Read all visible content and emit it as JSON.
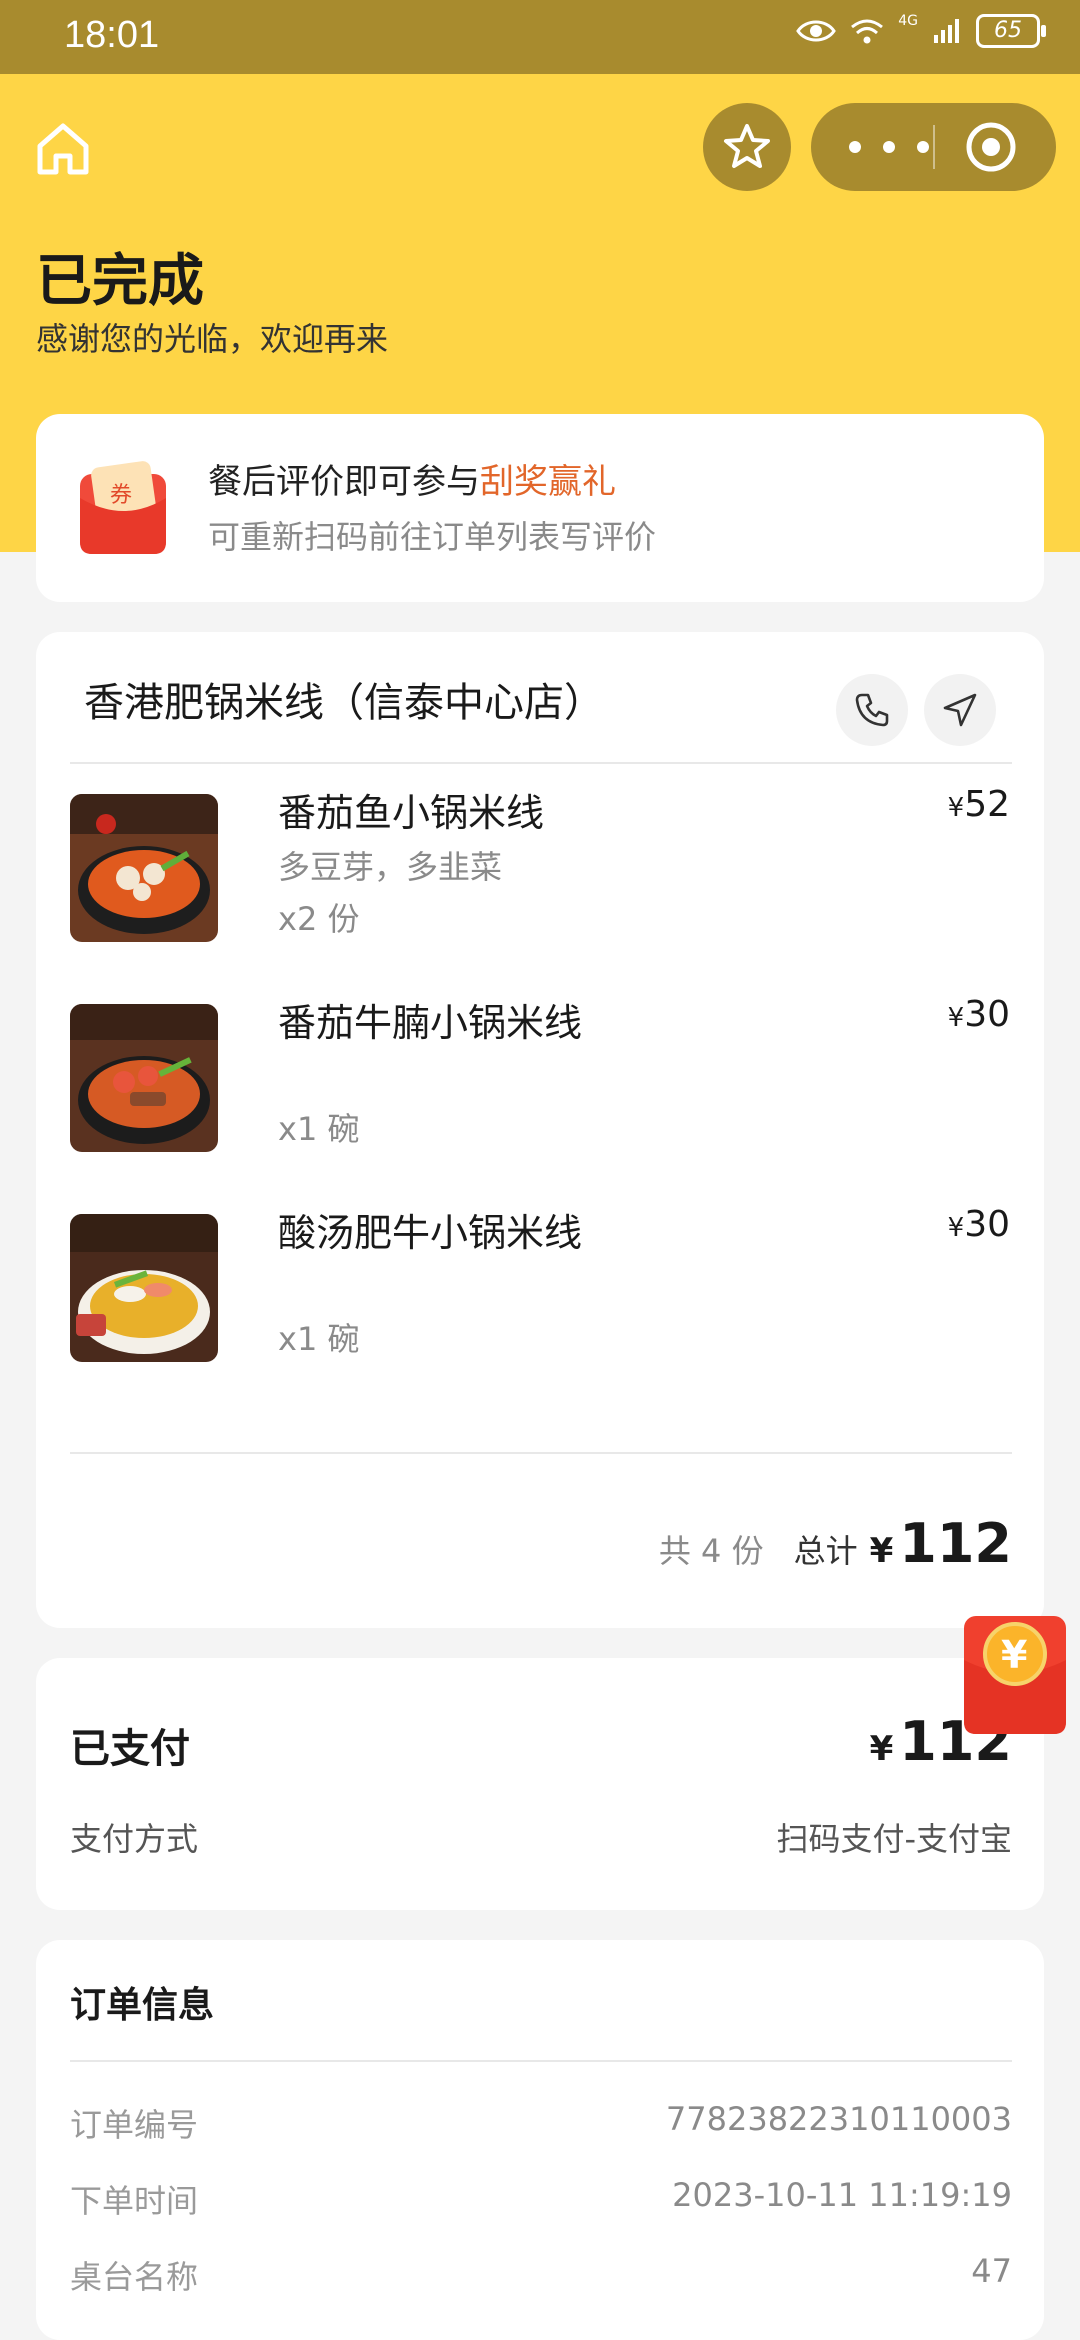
{
  "status_bar": {
    "time": "18:01",
    "network": "4G",
    "battery": "65"
  },
  "header": {
    "title": "已完成",
    "subtitle": "感谢您的光临，欢迎再来"
  },
  "nav_icons": [
    "home-icon",
    "star-icon",
    "more-icon",
    "target-icon"
  ],
  "promo": {
    "icon_text": "券",
    "line1_prefix": "餐后评价即可参与",
    "line1_highlight": "刮奖赢礼",
    "line2": "可重新扫码前往订单列表写评价",
    "highlight_color": "#e2662a"
  },
  "order": {
    "shop_name": "香港肥锅米线（信泰中心店）",
    "items": [
      {
        "name": "番茄鱼小锅米线",
        "note": "多豆芽，多韭菜",
        "qty": "x2 份",
        "currency": "¥",
        "price": "52"
      },
      {
        "name": "番茄牛腩小锅米线",
        "note": "",
        "qty": "x1 碗",
        "currency": "¥",
        "price": "30"
      },
      {
        "name": "酸汤肥牛小锅米线",
        "note": "",
        "qty": "x1 碗",
        "currency": "¥",
        "price": "30"
      }
    ],
    "count_text": "共 4 份",
    "total_label": "总计",
    "currency": "¥",
    "total": "112"
  },
  "payment": {
    "title": "已支付",
    "currency": "¥",
    "amount": "112",
    "method_label": "支付方式",
    "method_value": "扫码支付-支付宝"
  },
  "order_info": {
    "title": "订单信息",
    "rows": [
      {
        "label": "订单编号",
        "value": "77823822310110003"
      },
      {
        "label": "下单时间",
        "value": "2023-10-11 11:19:19"
      },
      {
        "label": "桌台名称",
        "value": "47"
      }
    ]
  },
  "floating_redpacket": {
    "symbol": "¥"
  },
  "colors": {
    "brand_yellow": "#fed546",
    "status_bar": "#a88b2e",
    "accent_orange": "#e2662a"
  }
}
